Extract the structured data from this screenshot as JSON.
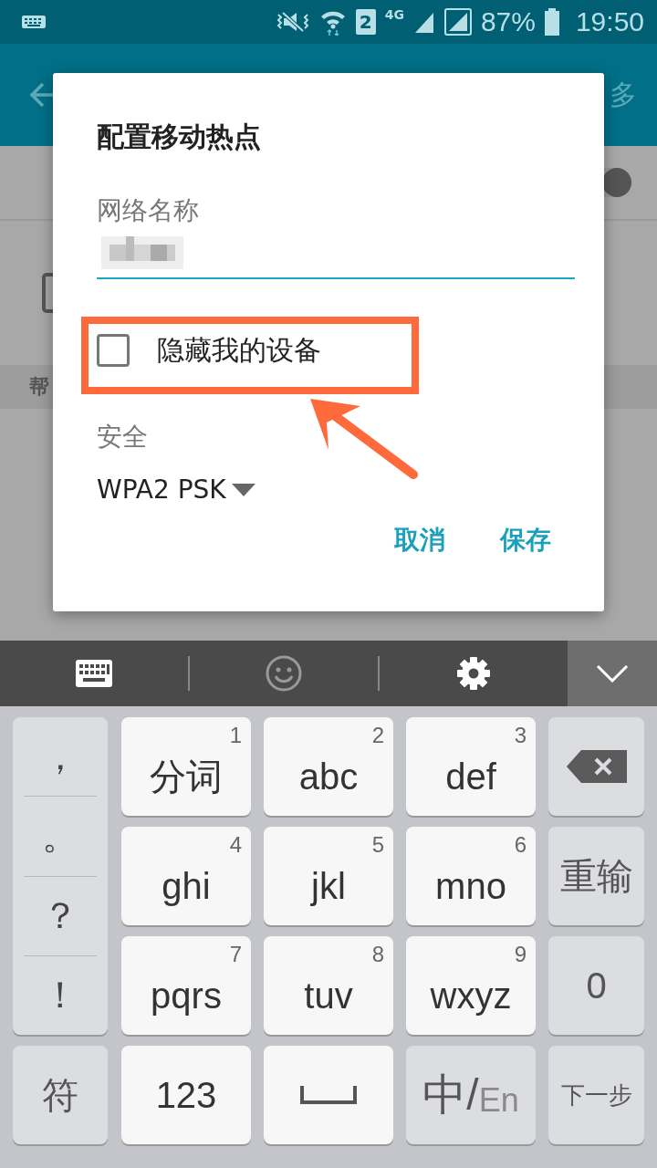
{
  "status_bar": {
    "sim_slot": "2",
    "network_type": "4G",
    "battery": "87%",
    "time": "19:50"
  },
  "background_screen": {
    "header_action": "多",
    "section_label": "帮",
    "switch_on": true
  },
  "dialog": {
    "title": "配置移动热点",
    "network_name": {
      "label": "网络名称"
    },
    "hide_device": {
      "label": "隐藏我的设备",
      "checked": false
    },
    "security": {
      "label": "安全",
      "value": "WPA2 PSK"
    },
    "buttons": [
      "取消",
      "保存"
    ]
  },
  "keyboard": {
    "punctuation": [
      "，",
      "。",
      "？",
      "！"
    ],
    "symbol_key": "符",
    "rows": [
      [
        {
          "kind": "letter",
          "label": "分词",
          "number": "1"
        },
        {
          "kind": "letter",
          "label": "abc",
          "number": "2"
        },
        {
          "kind": "letter",
          "label": "def",
          "number": "3"
        },
        {
          "kind": "delete"
        }
      ],
      [
        {
          "kind": "letter",
          "label": "ghi",
          "number": "4"
        },
        {
          "kind": "letter",
          "label": "jkl",
          "number": "5"
        },
        {
          "kind": "letter",
          "label": "mno",
          "number": "6"
        },
        {
          "kind": "action",
          "label": "重输"
        }
      ],
      [
        {
          "kind": "letter",
          "label": "pqrs",
          "number": "7"
        },
        {
          "kind": "letter",
          "label": "tuv",
          "number": "8"
        },
        {
          "kind": "letter",
          "label": "wxyz",
          "number": "9"
        },
        {
          "kind": "action",
          "label": "0"
        }
      ],
      [
        {
          "kind": "mode",
          "label": "123"
        },
        {
          "kind": "space"
        },
        {
          "kind": "lang",
          "primary": "中/",
          "secondary": "En"
        },
        {
          "kind": "small_action",
          "label": "下一步"
        }
      ]
    ]
  }
}
